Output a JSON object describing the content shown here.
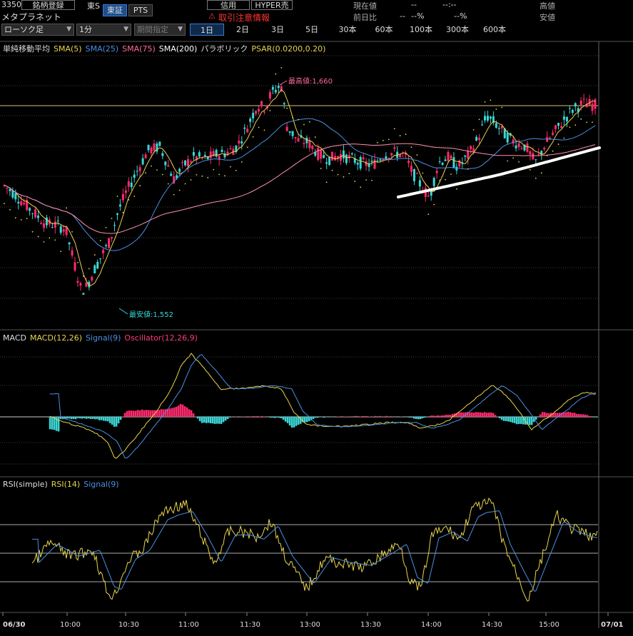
{
  "header": {
    "code": "3350",
    "name": "メタプラネット",
    "watch_button": "銘柄登録",
    "market": "東S",
    "exch_tab_tse": "東証",
    "exch_tab_pts": "PTS",
    "credit_button": "信用",
    "hyper_button": "HYPER売",
    "warning": "取引注意情報",
    "price_label": "現在値",
    "price_value": "--",
    "time_value": "--:--",
    "change_label": "前日比",
    "change_value": "--",
    "change_pct": "--%",
    "change_pct2": "--%",
    "high_label": "高値",
    "low_label": "安値"
  },
  "controls": {
    "chart_type": "ローソク足",
    "interval": "1分",
    "period_select": "期間指定",
    "timeframes": [
      "1日",
      "2日",
      "3日",
      "5日",
      "30本",
      "60本",
      "100本",
      "300本",
      "600本"
    ],
    "active_timeframe": 0
  },
  "legends": {
    "main": [
      {
        "text": "単純移動平均",
        "color": "#dddddd"
      },
      {
        "text": "SMA(5)",
        "color": "#e8d44d"
      },
      {
        "text": "SMA(25)",
        "color": "#4a90e2"
      },
      {
        "text": "SMA(75)",
        "color": "#ff6a9a"
      },
      {
        "text": "SMA(200)",
        "color": "#ffffff"
      },
      {
        "text": "パラボリック",
        "color": "#dddddd"
      },
      {
        "text": "PSAR(0.0200,0.20)",
        "color": "#e8d44d"
      }
    ],
    "macd": [
      {
        "text": "MACD",
        "color": "#dddddd"
      },
      {
        "text": "MACD(12,26)",
        "color": "#e8d44d"
      },
      {
        "text": "Signal(9)",
        "color": "#4a90e2"
      },
      {
        "text": "Oscillator(12,26,9)",
        "color": "#ff3a7a"
      }
    ],
    "rsi": [
      {
        "text": "RSI(simple)",
        "color": "#dddddd"
      },
      {
        "text": "RSI(14)",
        "color": "#e8d44d"
      },
      {
        "text": "Signal(9)",
        "color": "#4a90e2"
      }
    ]
  },
  "annotations": {
    "high": "最高値:1,660",
    "low": "最安値:1,552"
  },
  "chart_data": [
    {
      "type": "line",
      "panel": "price",
      "x_labels": [
        "06/30",
        "10:00",
        "10:30",
        "11:00",
        "11:30",
        "13:00",
        "13:30",
        "14:00",
        "14:30",
        "15:00",
        "07/01"
      ],
      "series": [
        {
          "name": "SMA(5)",
          "color": "#e8d44d",
          "values": [
            1612,
            1610,
            1606,
            1600,
            1592,
            1580,
            1568,
            1560,
            1565,
            1578,
            1596,
            1610,
            1622,
            1632,
            1640,
            1645,
            1648,
            1650,
            1655,
            1640,
            1630,
            1625,
            1622,
            1618,
            1615,
            1614,
            1612,
            1610,
            1612,
            1614,
            1608,
            1600,
            1598,
            1604,
            1612,
            1620,
            1626,
            1630,
            1632,
            1630,
            1624,
            1618,
            1622,
            1630,
            1638,
            1645,
            1648
          ]
        },
        {
          "name": "SMA(25)",
          "color": "#4a90e2",
          "values": [
            1618,
            1616,
            1612,
            1608,
            1600,
            1592,
            1584,
            1576,
            1570,
            1570,
            1576,
            1586,
            1596,
            1606,
            1616,
            1624,
            1632,
            1638,
            1644,
            1642,
            1636,
            1630,
            1626,
            1622,
            1620,
            1618,
            1616,
            1614,
            1613,
            1614,
            1613,
            1610,
            1608,
            1608,
            1610,
            1614,
            1620,
            1626,
            1630,
            1632,
            1632,
            1628,
            1626,
            1628,
            1632,
            1636,
            1640
          ]
        }
      ],
      "annotations": {
        "high": 1660,
        "low": 1552
      }
    },
    {
      "type": "line",
      "panel": "macd",
      "series": [
        {
          "name": "MACD(12,26)",
          "color": "#e8d44d"
        },
        {
          "name": "Signal(9)",
          "color": "#4a90e2"
        },
        {
          "name": "Oscillator(12,26,9)",
          "color": "#ff3a7a"
        }
      ]
    },
    {
      "type": "line",
      "panel": "rsi",
      "series": [
        {
          "name": "RSI(14)",
          "color": "#e8d44d"
        },
        {
          "name": "Signal(9)",
          "color": "#4a90e2"
        }
      ]
    }
  ]
}
